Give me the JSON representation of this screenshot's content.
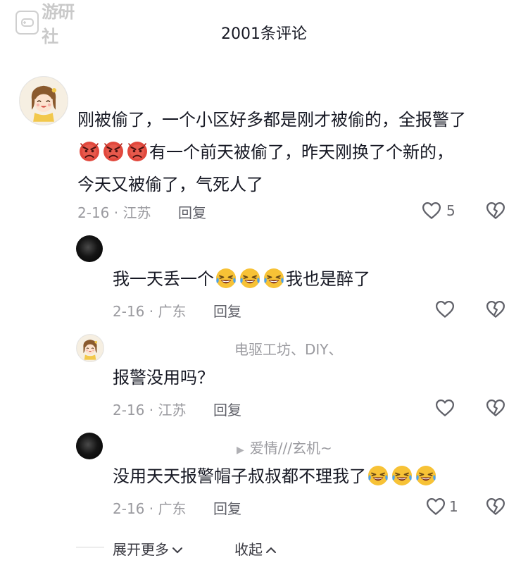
{
  "header": {
    "title": "2001条评论"
  },
  "watermark": {
    "text": "游研社"
  },
  "colors": {
    "text": "#161823",
    "meta": "#9a9a9f",
    "laugh": "#f7c236",
    "angry": "#e1483d"
  },
  "comments": [
    {
      "line1": "刚被偷了，一个小区好多都是刚才被偷的，全报警了",
      "line2_emojis": [
        "angry-face",
        "angry-face",
        "angry-face"
      ],
      "line2_text": "有一个前天被偷了，昨天刚换了个新的，",
      "line3": "今天又被偷了，气死人了",
      "date_location": "2-16 · 江苏",
      "reply": "回复",
      "likes": "5"
    }
  ],
  "replies": [
    {
      "text_before": "我一天丢一个",
      "emojis": [
        "laugh-cry",
        "laugh-cry",
        "laugh-cry"
      ],
      "text_after": "我也是醉了",
      "date_location": "2-16 · 广东",
      "reply": "回复",
      "likes": ""
    },
    {
      "author": "电驱工坊、DIY、",
      "text": "报警没用吗？",
      "date_location": "2-16 · 江苏",
      "reply": "回复",
      "likes": ""
    },
    {
      "author": "爱情///玄机~",
      "text": "没用天天报警帽子叔叔都不理我了",
      "emojis": [
        "laugh-cry",
        "laugh-cry",
        "laugh-cry"
      ],
      "date_location": "2-16 · 广东",
      "reply": "回复",
      "likes": "1"
    }
  ],
  "footer": {
    "expand": "展开更多",
    "collapse": "收起"
  }
}
